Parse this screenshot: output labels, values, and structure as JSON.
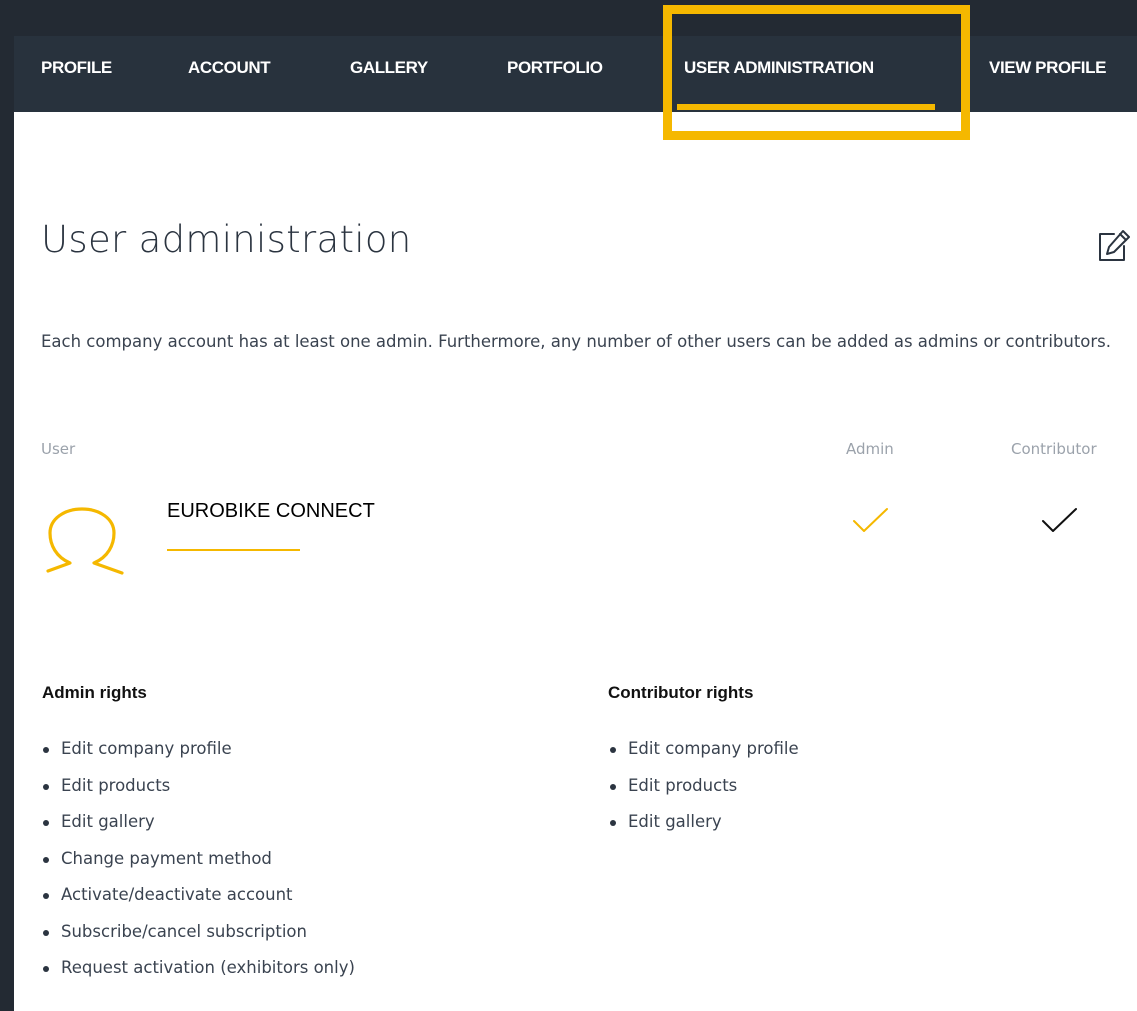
{
  "nav": {
    "items": [
      {
        "label": "PROFILE"
      },
      {
        "label": "ACCOUNT"
      },
      {
        "label": "GALLERY"
      },
      {
        "label": "PORTFOLIO"
      },
      {
        "label": "USER ADMINISTRATION",
        "active": true
      },
      {
        "label": "VIEW PROFILE"
      }
    ]
  },
  "page": {
    "title": "User administration",
    "intro": "Each company account has at least one admin. Furthermore, any number of other users can be added as admins or contributors."
  },
  "table": {
    "headers": {
      "user": "User",
      "admin": "Admin",
      "contributor": "Contributor"
    },
    "rows": [
      {
        "name": "EUROBIKE CONNECT",
        "admin": true,
        "contributor": true
      }
    ]
  },
  "rights": {
    "admin": {
      "title": "Admin rights",
      "items": [
        "Edit company profile",
        "Edit products",
        "Edit gallery",
        "Change payment method",
        "Activate/deactivate account",
        "Subscribe/cancel subscription",
        "Request activation (exhibitors only)"
      ]
    },
    "contributor": {
      "title": "Contributor rights",
      "items": [
        "Edit company profile",
        "Edit products",
        "Edit gallery"
      ]
    }
  },
  "colors": {
    "accent": "#f5b800",
    "nav_bg": "#28323d",
    "page_bg": "#ffffff",
    "frame_bg": "#232a33"
  },
  "icons": {
    "edit": "edit-icon",
    "avatar": "user-avatar-icon",
    "admin_check": "checkmark-icon",
    "contributor_check": "checkmark-icon"
  }
}
